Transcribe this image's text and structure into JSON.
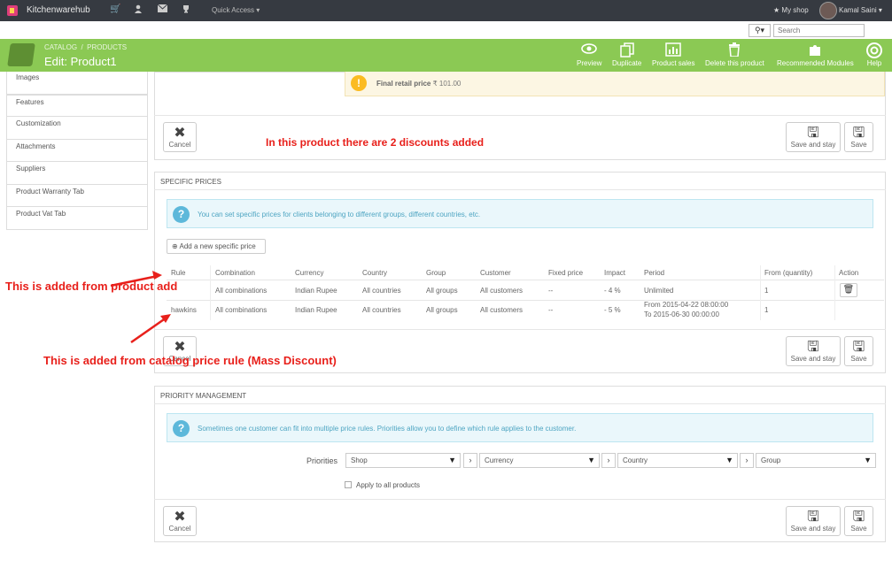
{
  "topbar": {
    "brand": "Kitchenwarehub",
    "quick_access": "Quick Access",
    "my_shop": "My shop",
    "user_name": "Kamal Saini"
  },
  "search": {
    "placeholder": "Search",
    "type_label": "Q"
  },
  "header": {
    "breadcrumb_1": "CATALOG",
    "breadcrumb_2": "PRODUCTS",
    "title": "Edit: Product1",
    "toolbar": [
      {
        "label": "Preview",
        "icon": "eye-icon"
      },
      {
        "label": "Duplicate",
        "icon": "copy-icon"
      },
      {
        "label": "Product sales",
        "icon": "bar-chart-icon"
      },
      {
        "label": "Delete this product",
        "icon": "trash-icon"
      },
      {
        "label": "Recommended Modules",
        "icon": "puzzle-icon"
      },
      {
        "label": "Help",
        "icon": "lifebuoy-icon"
      }
    ]
  },
  "sidebar": {
    "items": [
      "Images",
      "Features",
      "Customization",
      "Attachments",
      "Suppliers",
      "Product Warranty Tab",
      "Product Vat Tab"
    ]
  },
  "price_panel": {
    "final_label": "Final retail price",
    "final_value": "₹ 101.00"
  },
  "buttons": {
    "cancel": "Cancel",
    "save_and_stay": "Save and stay",
    "save": "Save"
  },
  "annotations": {
    "discounts": "In this product there are 2 discounts added",
    "product_add": "This is added from product add",
    "catalog_rule": "This is added from catalog price rule (Mass Discount)"
  },
  "specific_prices": {
    "heading": "SPECIFIC PRICES",
    "info": "You can set specific prices for clients belonging to different groups, different countries, etc.",
    "add_button": "Add a new specific price",
    "columns": [
      "Rule",
      "Combination",
      "Currency",
      "Country",
      "Group",
      "Customer",
      "Fixed price",
      "Impact",
      "Period",
      "From (quantity)",
      "Action"
    ],
    "rows": [
      {
        "rule": "",
        "combination": "All combinations",
        "currency": "Indian Rupee",
        "country": "All countries",
        "group": "All groups",
        "customer": "All customers",
        "fixed_price": "--",
        "impact": "- 4 %",
        "period_1": "Unlimited",
        "period_2": "",
        "quantity": "1"
      },
      {
        "rule": "hawkins",
        "combination": "All combinations",
        "currency": "Indian Rupee",
        "country": "All countries",
        "group": "All groups",
        "customer": "All customers",
        "fixed_price": "--",
        "impact": "- 5 %",
        "period_1": "From 2015-04-22 08:00:00",
        "period_2": "To 2015-06-30 00:00:00",
        "quantity": "1"
      }
    ]
  },
  "priority": {
    "heading": "PRIORITY MANAGEMENT",
    "info": "Sometimes one customer can fit into multiple price rules. Priorities allow you to define which rule applies to the customer.",
    "label": "Priorities",
    "selects": [
      "Shop",
      "Currency",
      "Country",
      "Group"
    ],
    "apply_all": "Apply to all products"
  },
  "colors": {
    "header_green": "#8bc954",
    "topbar": "#363a41",
    "annotation_red": "#e8201b"
  }
}
